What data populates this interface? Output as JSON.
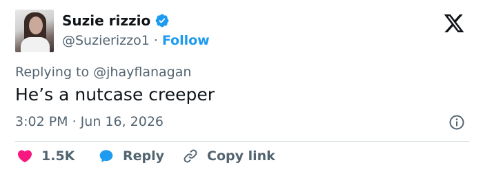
{
  "user": {
    "name": "Suzie rizzio",
    "handle": "@Suzierizzo1",
    "separator": "·",
    "follow_label": "Follow"
  },
  "tweet": {
    "replying_to": "Replying to @jhayflanagan",
    "text": "He’s a nutcase creeper",
    "timestamp": "3:02 PM · Jun 16, 2026"
  },
  "actions": {
    "likes": "1.5K",
    "reply_label": "Reply",
    "copy_link_label": "Copy link"
  },
  "icons": {
    "avatar": "profile-photo",
    "verified": "verified-badge-icon",
    "x_logo": "x-logo-icon",
    "info": "info-icon",
    "like": "heart-icon",
    "reply": "speech-bubble-icon",
    "copy": "link-icon"
  },
  "colors": {
    "accent": "#1d9bf0",
    "like": "#f91880",
    "text": "#0f1419",
    "secondary": "#536471"
  }
}
